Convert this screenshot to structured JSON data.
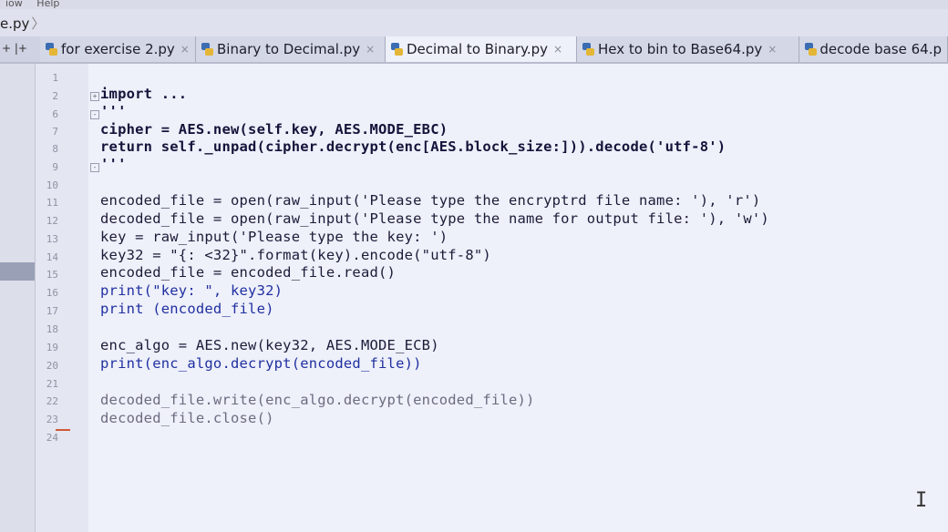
{
  "menubar": {
    "items": [
      "iow",
      "Help"
    ]
  },
  "breadcrumb": {
    "file": "e.py",
    "separator": "〉"
  },
  "tabbar": {
    "ctrl": "+ |+",
    "tabs": [
      {
        "label": "for exercise 2.py"
      },
      {
        "label": "Binary to Decimal.py"
      },
      {
        "label": "Decimal to Binary.py"
      },
      {
        "label": "Hex to bin to Base64.py"
      },
      {
        "label": "decode base 64.p"
      }
    ],
    "close_glyph": "×"
  },
  "editor": {
    "lines": [
      {
        "n": "1",
        "text": ""
      },
      {
        "n": "2",
        "text": "import ..."
      },
      {
        "n": "6",
        "text": "'''"
      },
      {
        "n": "7",
        "text": "cipher = AES.new(self.key, AES.MODE_EBC)"
      },
      {
        "n": "8",
        "text": "return self._unpad(cipher.decrypt(enc[AES.block_size:])).decode('utf-8')"
      },
      {
        "n": "9",
        "text": "'''"
      },
      {
        "n": "10",
        "text": ""
      },
      {
        "n": "11",
        "text": "encoded_file = open(raw_input('Please type the encryptrd file name: '), 'r')"
      },
      {
        "n": "12",
        "text": "decoded_file = open(raw_input('Please type the name for output file: '), 'w')"
      },
      {
        "n": "13",
        "text": "key = raw_input('Please type the key: ')"
      },
      {
        "n": "14",
        "text": "key32 = \"{: <32}\".format(key).encode(\"utf-8\")"
      },
      {
        "n": "15",
        "text": "encoded_file = encoded_file.read()"
      },
      {
        "n": "16",
        "text": "print(\"key: \", key32)"
      },
      {
        "n": "17",
        "text": "print (encoded_file)"
      },
      {
        "n": "18",
        "text": ""
      },
      {
        "n": "19",
        "text": "enc_algo = AES.new(key32, AES.MODE_ECB)"
      },
      {
        "n": "20",
        "text": "print(enc_algo.decrypt(encoded_file))"
      },
      {
        "n": "21",
        "text": ""
      },
      {
        "n": "22",
        "text": "decoded_file.write(enc_algo.decrypt(encoded_file))"
      },
      {
        "n": "23",
        "text": "decoded_file.close()"
      },
      {
        "n": "24",
        "text": ""
      }
    ]
  },
  "cursor": {
    "glyph": "I"
  },
  "colors": {
    "editor_bg": "#eef0fa",
    "keyword": "#14143a",
    "builtin": "#2030a0",
    "error": "#d05a3a"
  },
  "icons": {
    "tab": "python-file-icon",
    "fold": "fold-toggle-icon",
    "cursor": "text-cursor-icon"
  }
}
